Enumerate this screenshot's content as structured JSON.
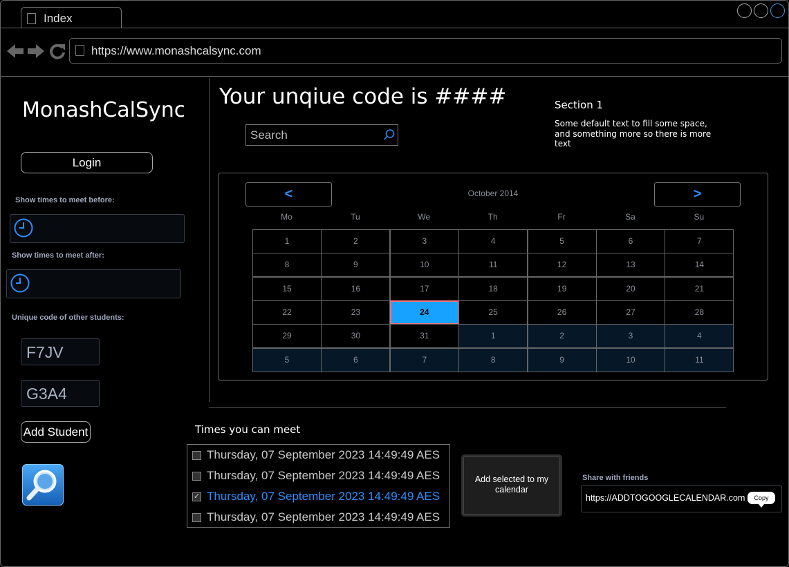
{
  "browser": {
    "tab_title": "Index",
    "url": "https://www.monashcalsync.com",
    "nav_icons": [
      "back-arrow-icon",
      "forward-arrow-icon",
      "reload-icon"
    ]
  },
  "sidebar": {
    "app_name": "MonashCalSync",
    "login_label": "Login",
    "before_label": "Show times to meet before:",
    "after_label": "Show times to meet after:",
    "codes_label": "Unique code of other students:",
    "codes": [
      "F7JV",
      "G3A4"
    ],
    "add_student_label": "Add Student",
    "search_icon": "magnifier-icon"
  },
  "main": {
    "unique_code_title": "Your unqiue code is ####",
    "search_placeholder": "Search",
    "section_title": "Section 1",
    "section_text": "Some default text to fill some space, and something more so there is more text"
  },
  "calendar": {
    "prev_label": "<",
    "next_label": ">",
    "month_label": "October 2014",
    "weekdays": [
      "Mo",
      "Tu",
      "We",
      "Th",
      "Fr",
      "Sa",
      "Su"
    ],
    "days": [
      "1",
      "2",
      "3",
      "4",
      "5",
      "6",
      "7",
      "8",
      "9",
      "10",
      "11",
      "12",
      "13",
      "14",
      "15",
      "16",
      "17",
      "18",
      "19",
      "20",
      "21",
      "22",
      "23",
      "24",
      "25",
      "26",
      "27",
      "28",
      "29",
      "30",
      "31",
      "1",
      "2",
      "3",
      "4",
      "5",
      "6",
      "7",
      "8",
      "9",
      "10",
      "11"
    ],
    "selected_day": "24",
    "colors": {
      "selected_bg": "#17a2ff",
      "selected_border": "#ff6f7a",
      "other_month_bg": "#061727"
    }
  },
  "times": {
    "title": "Times you can meet",
    "items": [
      {
        "label": "Thursday, 07 September 2023 14:49:49 AES",
        "checked": false
      },
      {
        "label": "Thursday, 07 September 2023 14:49:49 AES",
        "checked": false
      },
      {
        "label": "Thursday, 07 September 2023 14:49:49 AES",
        "checked": true
      },
      {
        "label": "Thursday, 07 September 2023 14:49:49 AES",
        "checked": false
      }
    ]
  },
  "add_to_calendar_label": "Add selected to my calendar",
  "share": {
    "label": "Share with friends",
    "url": "https://ADDTOGOOGLECALENDAR.com",
    "copy_label": "Copy"
  }
}
